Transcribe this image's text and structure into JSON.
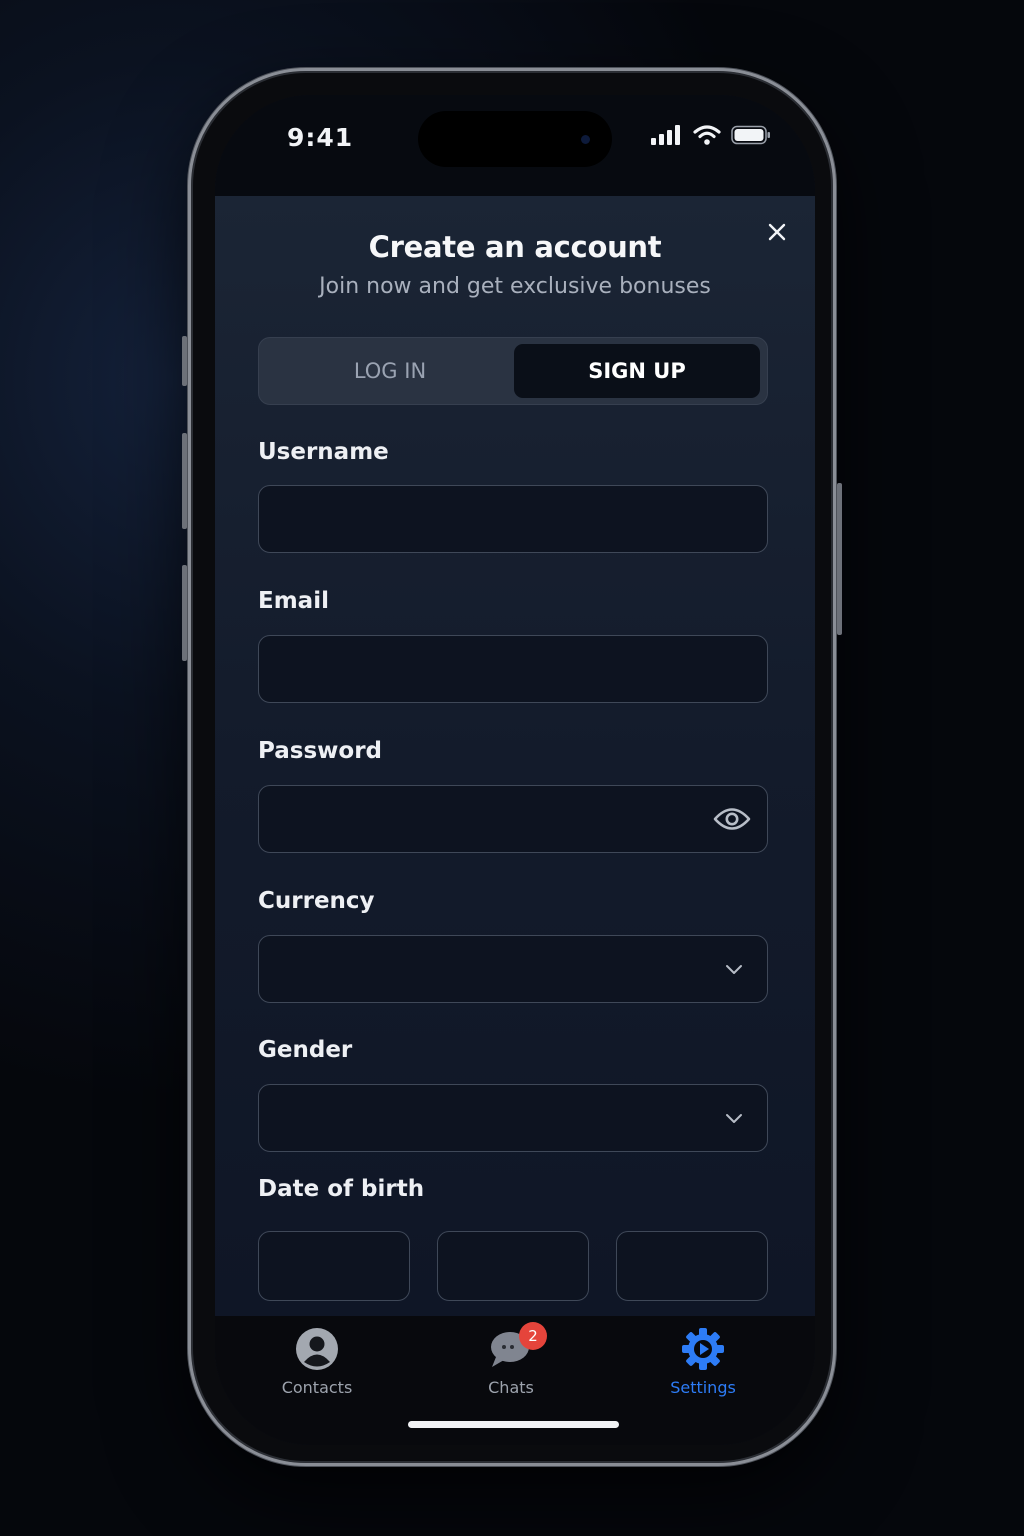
{
  "status_bar": {
    "time": "9:41"
  },
  "header": {
    "title": "Create an account",
    "subtitle": "Join now and get exclusive bonuses",
    "close_icon": "close-icon"
  },
  "tabs": [
    {
      "label": "LOG IN",
      "active": false
    },
    {
      "label": "SIGN UP",
      "active": true
    }
  ],
  "form": {
    "username": {
      "label": "Username",
      "value": "",
      "placeholder": ""
    },
    "email": {
      "label": "Email",
      "value": "",
      "placeholder": ""
    },
    "password": {
      "label": "Password",
      "value": "",
      "placeholder": "",
      "icon": "eye-icon"
    },
    "currency": {
      "label": "Currency",
      "value": "",
      "icon": "chevron-down-icon"
    },
    "gender": {
      "label": "Gender",
      "value": "",
      "icon": "chevron-down-icon"
    },
    "dob": {
      "label": "Date of birth",
      "day": "",
      "month": "",
      "year": ""
    }
  },
  "tab_bar": {
    "items": [
      {
        "label": "Contacts",
        "icon": "person-icon",
        "active": false
      },
      {
        "label": "Chats",
        "icon": "chat-icon",
        "badge": "2",
        "active": false
      },
      {
        "label": "Settings",
        "icon": "gear-icon",
        "active": true
      }
    ]
  },
  "colors": {
    "accent": "#2d7cf6",
    "badge": "#e5443b",
    "background": "#0e1422"
  }
}
